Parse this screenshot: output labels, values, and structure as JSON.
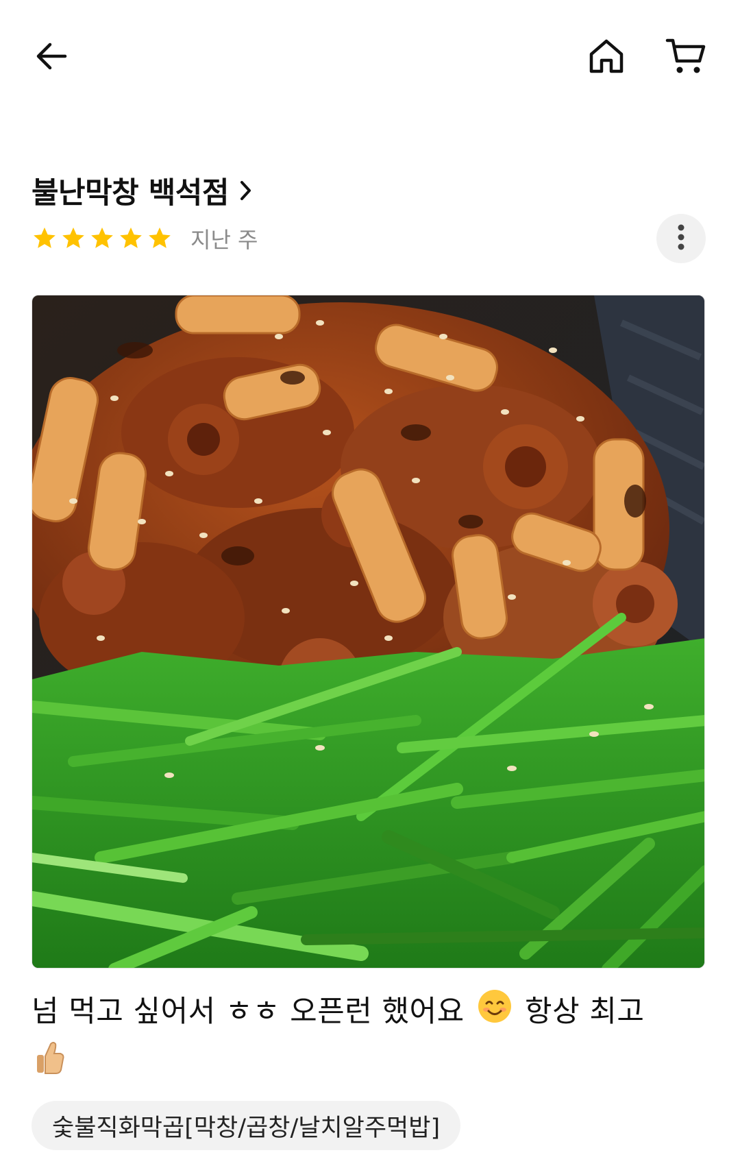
{
  "store": {
    "name": "불난막창 백석점"
  },
  "review": {
    "rating": 5,
    "rating_max": 5,
    "time": "지난 주",
    "text_part1": "넘 먹고 싶어서 ㅎㅎ 오픈런 했어요",
    "text_part2": "항상 최고",
    "emojis": [
      "smiling-face-emoji",
      "thumbs-up-emoji"
    ]
  },
  "menu_tag": "숯불직화막곱[막창/곱창/날치알주먹밥]",
  "icons": {
    "back": "back-arrow-icon",
    "home": "home-icon",
    "cart": "cart-icon",
    "more": "more-vertical-icon",
    "chevron": "chevron-right-icon",
    "star": "star-icon"
  },
  "colors": {
    "star": "#FFC200",
    "muted_text": "#8A8A8A",
    "chip_bg": "#F2F2F2"
  }
}
